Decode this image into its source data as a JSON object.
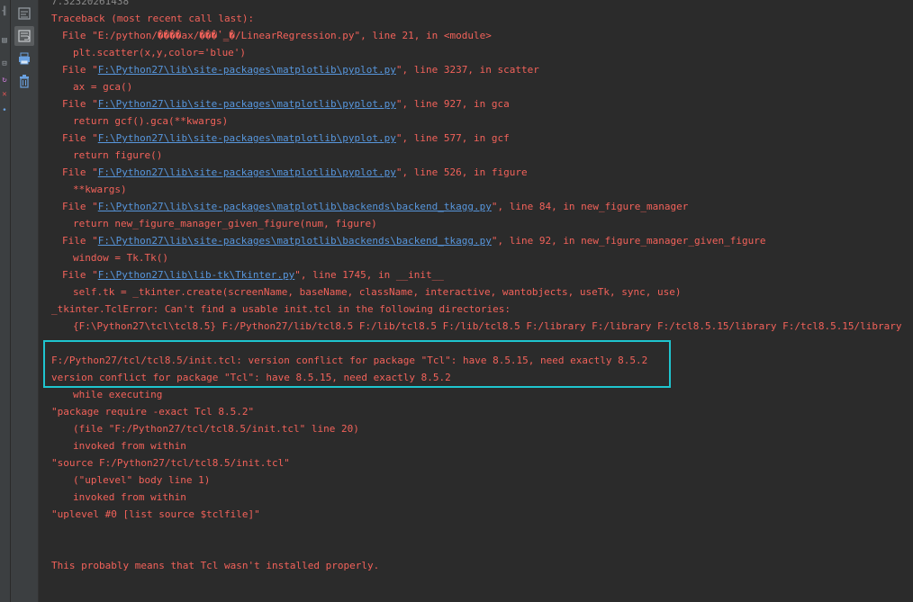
{
  "sidebar_marks": [
    {
      "glyph": "╢",
      "color": "#9aa0a6"
    },
    {
      "glyph": "▤",
      "color": "#9aa0a6"
    },
    {
      "glyph": "⊟",
      "color": "#9aa0a6"
    },
    {
      "glyph": "↻",
      "color": "#c97ad6"
    },
    {
      "glyph": "✕",
      "color": "#e05555"
    },
    {
      "glyph": "•",
      "color": "#6aa1e0"
    }
  ],
  "toolbar": {
    "icons": [
      "rerun-icon",
      "soft-wrap-icon",
      "print-icon",
      "trash-icon"
    ]
  },
  "console": {
    "top_partial": "7.32320261438",
    "tb_header": "Traceback (most recent call last):",
    "f1_pre": "File \"E:/python/����ax/���ʽ̳�/LinearRegression.py\", line 21, in <module>",
    "c1": "plt.scatter(x,y,color='blue')",
    "f2_pre": "File \"",
    "f2_link": "F:\\Python27\\lib\\site-packages\\matplotlib\\pyplot.py",
    "f2_post": "\", line 3237, in scatter",
    "c2": "ax = gca()",
    "f3_pre": "File \"",
    "f3_link": "F:\\Python27\\lib\\site-packages\\matplotlib\\pyplot.py",
    "f3_post": "\", line 927, in gca",
    "c3": "return gcf().gca(**kwargs)",
    "f4_pre": "File \"",
    "f4_link": "F:\\Python27\\lib\\site-packages\\matplotlib\\pyplot.py",
    "f4_post": "\", line 577, in gcf",
    "c4": "return figure()",
    "f5_pre": "File \"",
    "f5_link": "F:\\Python27\\lib\\site-packages\\matplotlib\\pyplot.py",
    "f5_post": "\", line 526, in figure",
    "c5": "**kwargs)",
    "f6_pre": "File \"",
    "f6_link": "F:\\Python27\\lib\\site-packages\\matplotlib\\backends\\backend_tkagg.py",
    "f6_post": "\", line 84, in new_figure_manager",
    "c6": "return new_figure_manager_given_figure(num, figure)",
    "f7_pre": "File \"",
    "f7_link": "F:\\Python27\\lib\\site-packages\\matplotlib\\backends\\backend_tkagg.py",
    "f7_post": "\", line 92, in new_figure_manager_given_figure",
    "c7": "window = Tk.Tk()",
    "f8_pre": "File \"",
    "f8_link": "F:\\Python27\\lib\\lib-tk\\Tkinter.py",
    "f8_post": "\", line 1745, in __init__",
    "c8": "self.tk = _tkinter.create(screenName, baseName, className, interactive, wantobjects, useTk, sync, use)",
    "err1": "_tkinter.TclError: Can't find a usable init.tcl in the following directories:",
    "err2": "{F:\\Python27\\tcl\\tcl8.5} F:/Python27/lib/tcl8.5 F:/lib/tcl8.5 F:/lib/tcl8.5 F:/library F:/library F:/tcl8.5.15/library F:/tcl8.5.15/library",
    "hl1": "F:/Python27/tcl/tcl8.5/init.tcl: version conflict for package \"Tcl\": have 8.5.15, need exactly 8.5.2",
    "hl2": "version conflict for package \"Tcl\": have 8.5.15, need exactly 8.5.2",
    "t1": "while executing",
    "t2": "\"package require -exact Tcl 8.5.2\"",
    "t3": "(file \"F:/Python27/tcl/tcl8.5/init.tcl\" line 20)",
    "t4": "invoked from within",
    "t5": "\"source F:/Python27/tcl/tcl8.5/init.tcl\"",
    "t6": "(\"uplevel\" body line 1)",
    "t7": "invoked from within",
    "t8": "\"uplevel #0 [list source $tclfile]\"",
    "final": "This probably means that Tcl wasn't installed properly."
  },
  "colors": {
    "error_text": "#f2625a",
    "link_text": "#5796dc",
    "highlight_border": "#1fc5cf",
    "console_bg": "#2b2b2b"
  }
}
